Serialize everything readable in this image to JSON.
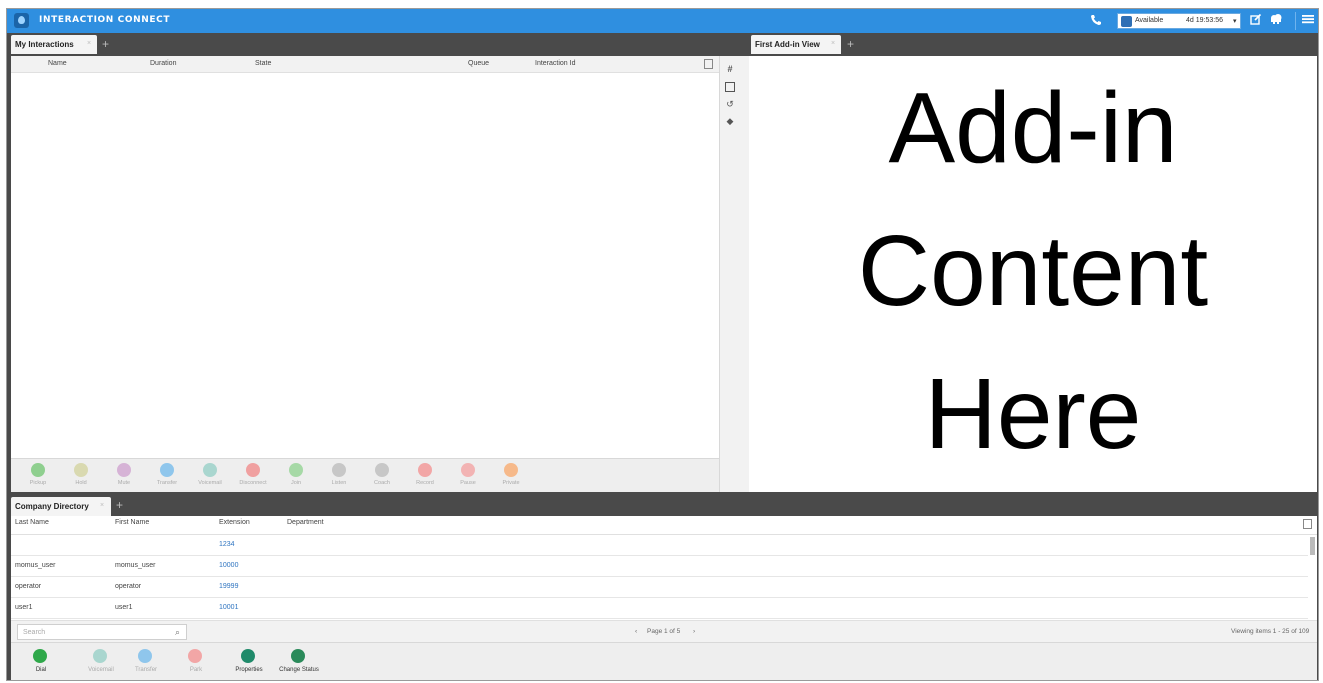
{
  "header": {
    "app_title": "INTERACTION CONNECT",
    "status_label": "Available",
    "status_time": "4d 19:53:56",
    "caret": "▾",
    "icons": [
      "phone-icon",
      "edit-icon",
      "cloud-icon",
      "menu-icon"
    ]
  },
  "interactions": {
    "tab_label": "My Interactions",
    "tab_close": "×",
    "tab_add": "+",
    "columns": [
      "Name",
      "Duration",
      "State",
      "Queue",
      "Interaction Id"
    ],
    "side_icons": [
      "hash-icon",
      "clipboard-icon",
      "history-icon",
      "tag-icon"
    ],
    "toolbar": [
      {
        "label": "Pickup",
        "color": "#8fcf8f"
      },
      {
        "label": "Hold",
        "color": "#d9d9b0"
      },
      {
        "label": "Mute",
        "color": "#d6b3d6"
      },
      {
        "label": "Transfer",
        "color": "#8fc6ec"
      },
      {
        "label": "Voicemail",
        "color": "#a9d6cf"
      },
      {
        "label": "Disconnect",
        "color": "#f0a0a0"
      },
      {
        "label": "Join",
        "color": "#a6d9a6"
      },
      {
        "label": "Listen",
        "color": "#c7c7c7"
      },
      {
        "label": "Coach",
        "color": "#c7c7c7"
      },
      {
        "label": "Record",
        "color": "#f2a6a6"
      },
      {
        "label": "Pause",
        "color": "#f2b3b3"
      },
      {
        "label": "Private",
        "color": "#f6b98a"
      }
    ]
  },
  "addin": {
    "tab_label": "First Add-in View",
    "tab_close": "×",
    "tab_add": "+",
    "lines": [
      "Add-in",
      "Content",
      "Here"
    ]
  },
  "directory": {
    "tab_label": "Company Directory",
    "tab_close": "×",
    "tab_add": "+",
    "columns": [
      "Last Name",
      "First Name",
      "Extension",
      "Department"
    ],
    "rows": [
      {
        "last": "",
        "first": "",
        "ext": "1234"
      },
      {
        "last": "momus_user",
        "first": "momus_user",
        "ext": "10000"
      },
      {
        "last": "operator",
        "first": "operator",
        "ext": "19999"
      },
      {
        "last": "user1",
        "first": "user1",
        "ext": "10001"
      }
    ],
    "search_placeholder": "Search",
    "page_label": "Page 1 of 5",
    "viewing_label": "Viewing items 1 - 25 of 109",
    "toolbar": [
      {
        "label": "Dial",
        "color": "#2fa84a",
        "enabled": true
      },
      {
        "label": "Voicemail",
        "color": "#a9d6cf",
        "enabled": false
      },
      {
        "label": "Transfer",
        "color": "#8fc6ec",
        "enabled": false
      },
      {
        "label": "Park",
        "color": "#f2a6a6",
        "enabled": false
      },
      {
        "label": "Properties",
        "color": "#1f8a6a",
        "enabled": true
      },
      {
        "label": "Change Status",
        "color": "#2a8a5a",
        "enabled": true
      }
    ]
  }
}
